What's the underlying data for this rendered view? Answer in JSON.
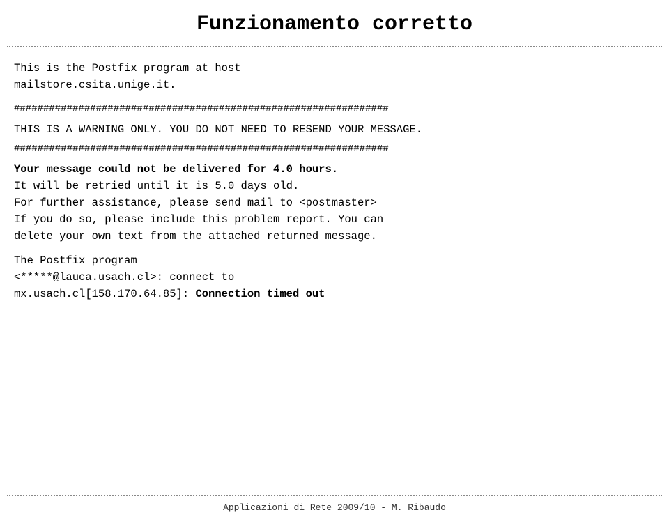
{
  "page": {
    "title": "Funzionamento corretto",
    "top_dotted_line": "dotted separator",
    "bottom_dotted_line": "dotted separator"
  },
  "content": {
    "intro_line1": "This is the Postfix program at host",
    "intro_line2": "mailstore.csita.unige.it.",
    "hash_line1": "################################################################",
    "warning_line1": "THIS IS A WARNING ONLY.",
    "warning_line2": "YOU DO NOT NEED TO RESEND YOUR MESSAGE.",
    "hash_line2": "################################################################",
    "delivery_line1": "Your message could not be delivered for 4.0 hours.",
    "delivery_line2": "It will be retried until it is 5.0 days old.",
    "assistance_line1": "For further assistance, please send mail to <postmaster>",
    "assistance_line2": "If you do so, please include this problem report. You can",
    "assistance_line3": "delete your own text from the attached returned message.",
    "postfix_line1": "The Postfix program",
    "postfix_line2": "<*****@lauca.usach.cl>: connect to",
    "postfix_line3_plain": "mx.usach.cl[158.170.64.85]: ",
    "postfix_line3_bold": "Connection timed out"
  },
  "footer": {
    "text": "Applicazioni di Rete 2009/10 - M. Ribaudo"
  }
}
